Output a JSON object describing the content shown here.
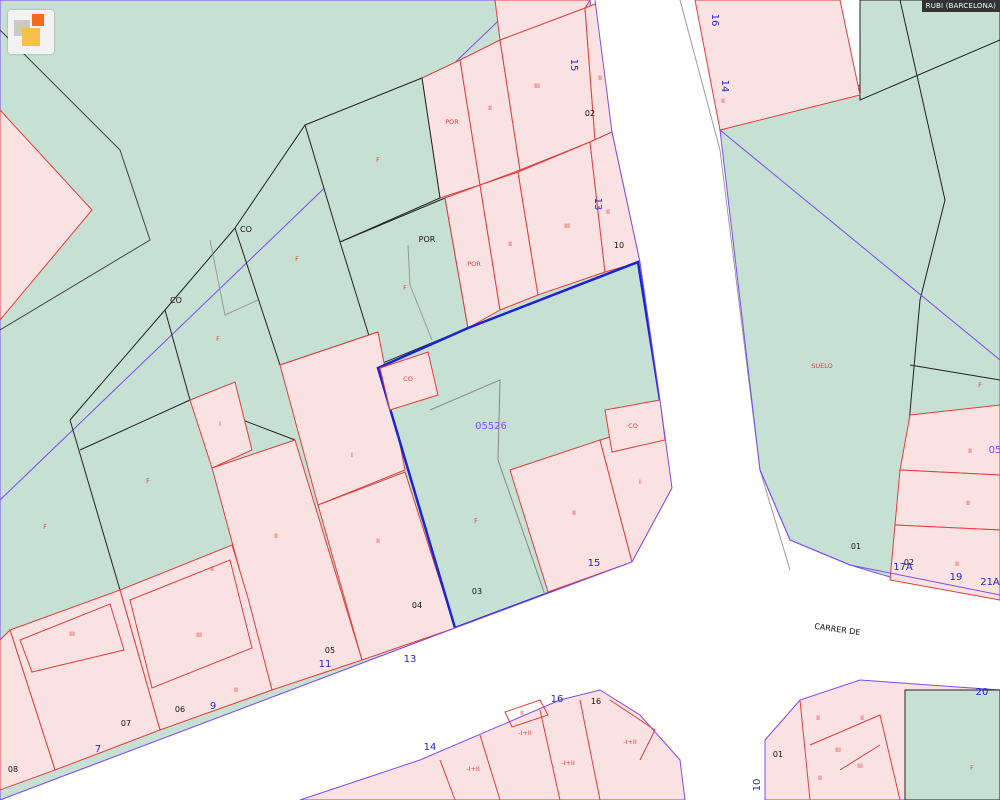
{
  "place_label": "RUBI (BARCELONA)",
  "street_label": "CARRER DE",
  "colors": {
    "road": "#ffffff",
    "green_parcel": "#c7e0d4",
    "pink_parcel": "#fbe2e2",
    "building_outline": "#e23d3d",
    "parcel_outline": "#222222",
    "boundary": "#7a4cf0",
    "selection": "#1a23d6",
    "street_number": "#2326c9",
    "parcel_code": "#8a4cf0"
  },
  "icons": {
    "logo": "map-service-logo-icon"
  },
  "labels": {
    "p_por_top": "POR",
    "p_ii_a": "II",
    "p_iii_a": "III",
    "p_ii_b": "II",
    "num_15_top": "15",
    "num_02": "02",
    "p_f_mid": "F",
    "p_por_mid": "POR",
    "p_por_red": "POR",
    "p_ii_c": "II",
    "p_iii_b": "III",
    "p_ii_d": "II",
    "num_13_side": "13",
    "num_10": "10",
    "p_co_a": "CO",
    "p_co_b": "CO",
    "p_f_a": "F",
    "p_f_b": "F",
    "p_f_c": "F",
    "p_co_c": "CO",
    "parcel_code": "05526",
    "p_co_d": "CO",
    "p_i_a": "I",
    "p_i_b": "I",
    "p_i_c": "I",
    "p_ii_e": "II",
    "p_ii_f": "II",
    "p_ii_g": "II",
    "p_f_d": "F",
    "p_f_e": "F",
    "p_f_f": "F",
    "num_03": "03",
    "num_15_mid": "15",
    "num_04": "04",
    "num_05": "05",
    "p_ii_h": "II",
    "p_iii_c": "III",
    "p_iii_d": "III",
    "p_ii_i": "II",
    "num_13_road": "13",
    "num_11": "11",
    "num_07": "07",
    "num_06": "06",
    "num_9": "9",
    "num_7": "7",
    "num_08": "08",
    "p_suelo": "SUELO",
    "num_01_right": "01",
    "num_02_right": "02",
    "num_17a": "17A",
    "num_19": "19",
    "num_21a": "21A",
    "p_f_right": "F",
    "p_ii_r1": "II",
    "p_ii_r2": "II",
    "p_ii_r3": "II",
    "code_05_right": "05",
    "num_16_top": "16",
    "num_14_top": "14",
    "p_ii_tr": "II",
    "num_16_bot": "16",
    "num_16_bot2": "16",
    "num_14_bot": "14",
    "p_ihii_a": "-I+II",
    "p_ihii_b": "-I+II",
    "p_ihii_c": "-I+II",
    "p_ihii_d": "-I+II",
    "p_ii_bot": "II",
    "num_20": "20",
    "num_01_br": "01",
    "num_10_br": "10",
    "p_ii_br1": "II",
    "p_iii_br1": "III",
    "p_ii_br2": "II",
    "p_iii_br2": "III",
    "p_ii_br3": "II",
    "p_f_br": "F"
  }
}
